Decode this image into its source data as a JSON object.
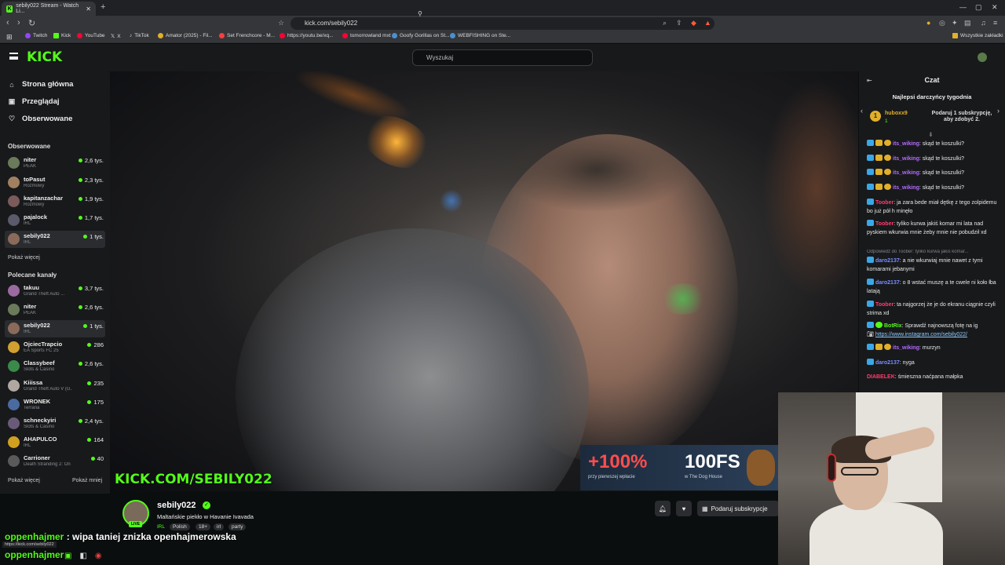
{
  "browser": {
    "tab_title": "sebily022 Stream - Watch Li...",
    "url": "kick.com/sebily022",
    "bookmarks": [
      "Twitch",
      "Kick",
      "YouTube",
      "X",
      "TikTok",
      "Amator (2025) - Fil...",
      "Set Frenchcore - M...",
      "https://youtu.be/xq...",
      "tomorrowland mxt",
      "Goofy Gorillas on St...",
      "WEBFISHING on Ste..."
    ],
    "bookmark_folder": "Wszystkie zakładki"
  },
  "header": {
    "logo": "KICK",
    "search_placeholder": "Wyszukaj"
  },
  "sidebar": {
    "nav": [
      "Strona główna",
      "Przeglądaj",
      "Obserwowane"
    ],
    "followed_title": "Obserwowane",
    "followed": [
      {
        "name": "niter",
        "category": "PEAK",
        "viewers": "2,6 tys.",
        "color": "#6b7a5a"
      },
      {
        "name": "toPasut",
        "category": "Rozmowy",
        "viewers": "2,3 tys.",
        "color": "#a08060"
      },
      {
        "name": "kapitanzachar",
        "category": "Rozmowy",
        "viewers": "1,9 tys.",
        "color": "#7a5a5a"
      },
      {
        "name": "pajalock",
        "category": "IRL",
        "viewers": "1,7 tys.",
        "color": "#5a5a6a"
      },
      {
        "name": "sebily022",
        "category": "IRL",
        "viewers": "1 tys.",
        "color": "#8a6a5a"
      }
    ],
    "show_more_followed": "Pokaż więcej",
    "recommended_title": "Polecane kanały",
    "recommended": [
      {
        "name": "takuu",
        "category": "Grand Theft Auto ...",
        "viewers": "3,7 tys.",
        "color": "#9a6aa0"
      },
      {
        "name": "niter",
        "category": "PEAK",
        "viewers": "2,6 tys.",
        "color": "#6b7a5a"
      },
      {
        "name": "sebily022",
        "category": "IRL",
        "viewers": "1 tys.",
        "color": "#8a6a5a"
      },
      {
        "name": "OjciecTrapcio",
        "category": "EA Sports FC 25",
        "viewers": "286",
        "color": "#d0a030"
      },
      {
        "name": "Classybeef",
        "category": "Slots & Casino",
        "viewers": "2,6 tys.",
        "color": "#3a8a4a"
      },
      {
        "name": "Kiiissa",
        "category": "Grand Theft Auto V (G...",
        "viewers": "235",
        "color": "#b0a8a0"
      },
      {
        "name": "WRONEK",
        "category": "Terraria",
        "viewers": "175",
        "color": "#4a6aa0"
      },
      {
        "name": "schneckyiri",
        "category": "Slots & Casino",
        "viewers": "2,4 tys.",
        "color": "#6a5a7a"
      },
      {
        "name": "AHAPULCO",
        "category": "IRL",
        "viewers": "164",
        "color": "#d0a020"
      },
      {
        "name": "Carrioner",
        "category": "Death Stranding 2: On ...",
        "viewers": "40",
        "color": "#5a5a5a"
      }
    ],
    "show_more_rec": "Pokaż więcej",
    "show_less_rec": "Pokaż mniej"
  },
  "video": {
    "watermark": "KICK.COM/SEBILY022",
    "ad_percent": "+100%",
    "ad_fs": "100FS",
    "ad_sub1": "przy pierwszej wpłacie",
    "ad_sub2": "w The Dog House"
  },
  "channel": {
    "name": "sebily022",
    "live_badge": "LIVE",
    "stream_title": "Maltańskie piekło w Havanie Ivavada",
    "category": "IRL",
    "tags": [
      "Polish",
      "18+",
      "irl",
      "party"
    ],
    "subscribe_label": "Podaruj subskrypcje"
  },
  "overlay": {
    "line1_name": "oppenhajmer",
    "line1_text": " : wipa taniej znizka openhajmerowska",
    "line2_name": "oppenhajmer",
    "status_url": "https://kick.com/sebily022"
  },
  "chat": {
    "title": "Czat",
    "gifter_title": "Najlepsi darczyńcy tygodnia",
    "gifter_name": "huboxx9",
    "gifter_count": "1",
    "gifter_cta": "Podaruj 1 subskrypcję, aby zdobyć 2.",
    "messages": [
      {
        "user": "its_wiking",
        "text": ": skąd te koszulki?",
        "color": "#b36bff",
        "badges": 3
      },
      {
        "user": "its_wiking",
        "text": ": skąd te koszulki?",
        "color": "#b36bff",
        "badges": 3
      },
      {
        "user": "its_wiking",
        "text": ": skąd te koszulki?",
        "color": "#b36bff",
        "badges": 3
      },
      {
        "user": "its_wiking",
        "text": ": skąd te koszulki?",
        "color": "#b36bff",
        "badges": 3
      },
      {
        "user": "Toober",
        "text": ": ja zara bede miał dętkę z tego zolpidemu bo już pół h minęło",
        "color": "#ff3d6e",
        "badges": 1
      },
      {
        "user": "Toober",
        "text": ": tyliko kurwa jakiś komar mi lata nad pyskiem wkurwia mnie żeby mnie nie pobudził xd",
        "color": "#ff3d6e",
        "badges": 1
      },
      {
        "user": "daro2137",
        "text": ": a nie wkurwiaj mnie nawet z tymi komarami jebanymi",
        "color": "#7a8cff",
        "badges": 1
      },
      {
        "user": "daro2137",
        "text": ": o 8 wstać muszę a te cwele ni koło łba latają",
        "color": "#7a8cff",
        "badges": 1
      },
      {
        "user": "Toober",
        "text": ": ta najgorzej że je do ekranu ciągnie czyli strima xd",
        "color": "#ff3d6e",
        "badges": 1
      },
      {
        "user": "BotRix",
        "text": ": Sprawdź najnowszą fotę na ig",
        "color": "#53fc18",
        "badges": 2
      },
      {
        "user": "its_wiking",
        "text": ": murzyn",
        "color": "#b36bff",
        "badges": 3
      },
      {
        "user": "daro2137",
        "text": ": nyga",
        "color": "#7a8cff",
        "badges": 1
      },
      {
        "user": "DIABELEK",
        "text": ": śmieszna naćpana małpka",
        "color": "#ff3d6e",
        "badges": 0
      }
    ],
    "reply_note": "Odpowiedź do Toober: tyliko kurwa jakiś komar...",
    "link": "https://www.instagram.com/sebily022/"
  }
}
